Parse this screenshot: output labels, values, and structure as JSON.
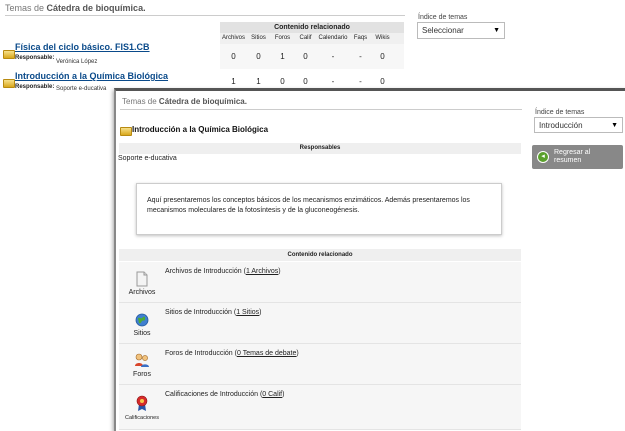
{
  "background": {
    "page_title_prefix": "Temas de",
    "page_title_bold": "Cátedra de bioquímica.",
    "index_label": "Índice de temas",
    "index_value": "Seleccionar",
    "table": {
      "header": "Contenido relacionado",
      "columns": [
        "Archivos",
        "Sitios",
        "Foros",
        "Calif",
        "Calendario",
        "Faqs",
        "Wikis"
      ],
      "rows": [
        [
          "0",
          "0",
          "1",
          "0",
          "-",
          "-",
          "0"
        ],
        [
          "1",
          "1",
          "0",
          "0",
          "-",
          "-",
          "0"
        ]
      ]
    },
    "topics": [
      {
        "title": "Física del ciclo básico. FIS1.CB",
        "resp_label": "Responsable:",
        "resp_value": "Verónica López"
      },
      {
        "title": "Introducción a la Química Biológica",
        "resp_label": "Responsable:",
        "resp_value": "Soporte e-ducativa"
      }
    ]
  },
  "overlay": {
    "page_title_prefix": "Temas de",
    "page_title_bold": "Cátedra de bioquímica.",
    "topic_title": "Introducción a la Química Biológica",
    "responsables_header": "Responsables",
    "responsable": "Soporte e-ducativa",
    "description": "Aquí presentaremos los conceptos básicos de los mecanismos enzimáticos. Además presentaremos los mecanismos moleculares de la fotosíntesis y de la gluconeogénesis.",
    "contenido_header": "Contenido relacionado",
    "index_label": "Índice de temas",
    "index_value": "Introducción",
    "back_button": "Regresar al resumen",
    "items": [
      {
        "icon_label": "Archivos",
        "text": "Archivos de Introducción (",
        "link": "1 Archivos",
        "suffix": ")",
        "icon": "file-icon"
      },
      {
        "icon_label": "Sitios",
        "text": "Sitios de Introducción (",
        "link": "1 Sitios",
        "suffix": ")",
        "icon": "globe-icon"
      },
      {
        "icon_label": "Foros",
        "text": "Foros de Introducción (",
        "link": "0 Temas de debate",
        "suffix": ")",
        "icon": "forum-icon"
      },
      {
        "icon_label": "Calificaciones",
        "text": "Calificaciones de Introducción (",
        "link": "0 Calif",
        "suffix": ")",
        "icon": "medal-icon"
      }
    ]
  }
}
